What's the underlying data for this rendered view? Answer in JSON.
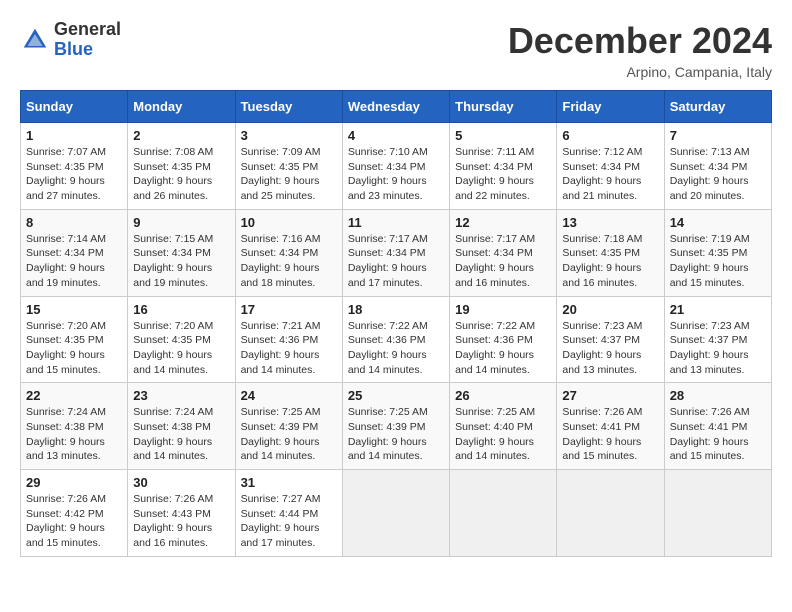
{
  "header": {
    "logo": {
      "general": "General",
      "blue": "Blue"
    },
    "title": "December 2024",
    "subtitle": "Arpino, Campania, Italy"
  },
  "weekdays": [
    "Sunday",
    "Monday",
    "Tuesday",
    "Wednesday",
    "Thursday",
    "Friday",
    "Saturday"
  ],
  "weeks": [
    [
      {
        "day": "1",
        "sunrise": "Sunrise: 7:07 AM",
        "sunset": "Sunset: 4:35 PM",
        "daylight": "Daylight: 9 hours and 27 minutes."
      },
      {
        "day": "2",
        "sunrise": "Sunrise: 7:08 AM",
        "sunset": "Sunset: 4:35 PM",
        "daylight": "Daylight: 9 hours and 26 minutes."
      },
      {
        "day": "3",
        "sunrise": "Sunrise: 7:09 AM",
        "sunset": "Sunset: 4:35 PM",
        "daylight": "Daylight: 9 hours and 25 minutes."
      },
      {
        "day": "4",
        "sunrise": "Sunrise: 7:10 AM",
        "sunset": "Sunset: 4:34 PM",
        "daylight": "Daylight: 9 hours and 23 minutes."
      },
      {
        "day": "5",
        "sunrise": "Sunrise: 7:11 AM",
        "sunset": "Sunset: 4:34 PM",
        "daylight": "Daylight: 9 hours and 22 minutes."
      },
      {
        "day": "6",
        "sunrise": "Sunrise: 7:12 AM",
        "sunset": "Sunset: 4:34 PM",
        "daylight": "Daylight: 9 hours and 21 minutes."
      },
      {
        "day": "7",
        "sunrise": "Sunrise: 7:13 AM",
        "sunset": "Sunset: 4:34 PM",
        "daylight": "Daylight: 9 hours and 20 minutes."
      }
    ],
    [
      {
        "day": "8",
        "sunrise": "Sunrise: 7:14 AM",
        "sunset": "Sunset: 4:34 PM",
        "daylight": "Daylight: 9 hours and 19 minutes."
      },
      {
        "day": "9",
        "sunrise": "Sunrise: 7:15 AM",
        "sunset": "Sunset: 4:34 PM",
        "daylight": "Daylight: 9 hours and 19 minutes."
      },
      {
        "day": "10",
        "sunrise": "Sunrise: 7:16 AM",
        "sunset": "Sunset: 4:34 PM",
        "daylight": "Daylight: 9 hours and 18 minutes."
      },
      {
        "day": "11",
        "sunrise": "Sunrise: 7:17 AM",
        "sunset": "Sunset: 4:34 PM",
        "daylight": "Daylight: 9 hours and 17 minutes."
      },
      {
        "day": "12",
        "sunrise": "Sunrise: 7:17 AM",
        "sunset": "Sunset: 4:34 PM",
        "daylight": "Daylight: 9 hours and 16 minutes."
      },
      {
        "day": "13",
        "sunrise": "Sunrise: 7:18 AM",
        "sunset": "Sunset: 4:35 PM",
        "daylight": "Daylight: 9 hours and 16 minutes."
      },
      {
        "day": "14",
        "sunrise": "Sunrise: 7:19 AM",
        "sunset": "Sunset: 4:35 PM",
        "daylight": "Daylight: 9 hours and 15 minutes."
      }
    ],
    [
      {
        "day": "15",
        "sunrise": "Sunrise: 7:20 AM",
        "sunset": "Sunset: 4:35 PM",
        "daylight": "Daylight: 9 hours and 15 minutes."
      },
      {
        "day": "16",
        "sunrise": "Sunrise: 7:20 AM",
        "sunset": "Sunset: 4:35 PM",
        "daylight": "Daylight: 9 hours and 14 minutes."
      },
      {
        "day": "17",
        "sunrise": "Sunrise: 7:21 AM",
        "sunset": "Sunset: 4:36 PM",
        "daylight": "Daylight: 9 hours and 14 minutes."
      },
      {
        "day": "18",
        "sunrise": "Sunrise: 7:22 AM",
        "sunset": "Sunset: 4:36 PM",
        "daylight": "Daylight: 9 hours and 14 minutes."
      },
      {
        "day": "19",
        "sunrise": "Sunrise: 7:22 AM",
        "sunset": "Sunset: 4:36 PM",
        "daylight": "Daylight: 9 hours and 14 minutes."
      },
      {
        "day": "20",
        "sunrise": "Sunrise: 7:23 AM",
        "sunset": "Sunset: 4:37 PM",
        "daylight": "Daylight: 9 hours and 13 minutes."
      },
      {
        "day": "21",
        "sunrise": "Sunrise: 7:23 AM",
        "sunset": "Sunset: 4:37 PM",
        "daylight": "Daylight: 9 hours and 13 minutes."
      }
    ],
    [
      {
        "day": "22",
        "sunrise": "Sunrise: 7:24 AM",
        "sunset": "Sunset: 4:38 PM",
        "daylight": "Daylight: 9 hours and 13 minutes."
      },
      {
        "day": "23",
        "sunrise": "Sunrise: 7:24 AM",
        "sunset": "Sunset: 4:38 PM",
        "daylight": "Daylight: 9 hours and 14 minutes."
      },
      {
        "day": "24",
        "sunrise": "Sunrise: 7:25 AM",
        "sunset": "Sunset: 4:39 PM",
        "daylight": "Daylight: 9 hours and 14 minutes."
      },
      {
        "day": "25",
        "sunrise": "Sunrise: 7:25 AM",
        "sunset": "Sunset: 4:39 PM",
        "daylight": "Daylight: 9 hours and 14 minutes."
      },
      {
        "day": "26",
        "sunrise": "Sunrise: 7:25 AM",
        "sunset": "Sunset: 4:40 PM",
        "daylight": "Daylight: 9 hours and 14 minutes."
      },
      {
        "day": "27",
        "sunrise": "Sunrise: 7:26 AM",
        "sunset": "Sunset: 4:41 PM",
        "daylight": "Daylight: 9 hours and 15 minutes."
      },
      {
        "day": "28",
        "sunrise": "Sunrise: 7:26 AM",
        "sunset": "Sunset: 4:41 PM",
        "daylight": "Daylight: 9 hours and 15 minutes."
      }
    ],
    [
      {
        "day": "29",
        "sunrise": "Sunrise: 7:26 AM",
        "sunset": "Sunset: 4:42 PM",
        "daylight": "Daylight: 9 hours and 15 minutes."
      },
      {
        "day": "30",
        "sunrise": "Sunrise: 7:26 AM",
        "sunset": "Sunset: 4:43 PM",
        "daylight": "Daylight: 9 hours and 16 minutes."
      },
      {
        "day": "31",
        "sunrise": "Sunrise: 7:27 AM",
        "sunset": "Sunset: 4:44 PM",
        "daylight": "Daylight: 9 hours and 17 minutes."
      },
      null,
      null,
      null,
      null
    ]
  ]
}
